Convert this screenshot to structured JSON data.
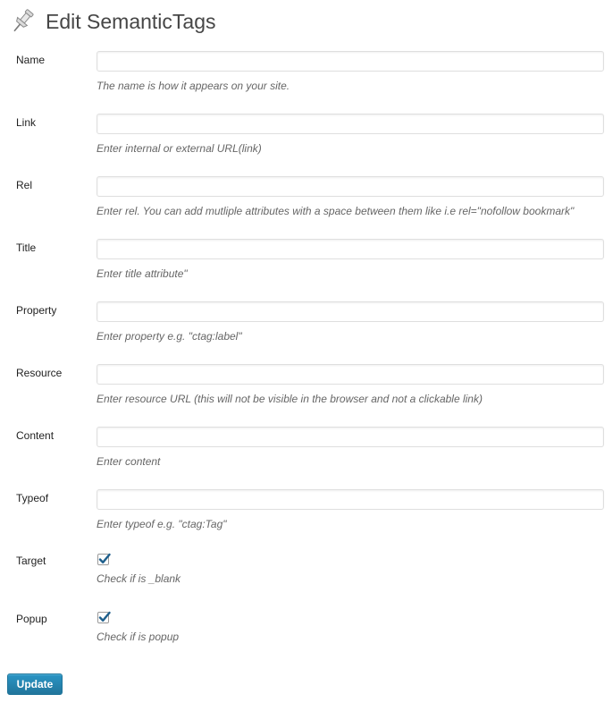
{
  "header": {
    "title": "Edit SemanticTags",
    "icon": "pushpin-icon"
  },
  "fields": [
    {
      "key": "name",
      "label": "Name",
      "value": "",
      "description": "The name is how it appears on your site."
    },
    {
      "key": "link",
      "label": "Link",
      "value": "",
      "description": "Enter internal or external URL(link)"
    },
    {
      "key": "rel",
      "label": "Rel",
      "value": "",
      "description": "Enter rel. You can add mutliple attributes with a space between them like i.e rel=\"nofollow bookmark\""
    },
    {
      "key": "title",
      "label": "Title",
      "value": "",
      "description": "Enter title attribute\""
    },
    {
      "key": "property",
      "label": "Property",
      "value": "",
      "description": "Enter property e.g. \"ctag:label\""
    },
    {
      "key": "resource",
      "label": "Resource",
      "value": "",
      "description": "Enter resource URL (this will not be visible in the browser and not a clickable link)"
    },
    {
      "key": "content",
      "label": "Content",
      "value": "",
      "description": "Enter content"
    },
    {
      "key": "typeof",
      "label": "Typeof",
      "value": "",
      "description": "Enter typeof e.g. \"ctag:Tag\""
    }
  ],
  "checkboxes": [
    {
      "key": "target",
      "label": "Target",
      "checked": true,
      "description": "Check if is _blank"
    },
    {
      "key": "popup",
      "label": "Popup",
      "checked": true,
      "description": "Check if is popup"
    }
  ],
  "actions": {
    "update_label": "Update"
  },
  "colors": {
    "button_primary": "#21759b",
    "check_mark": "#1e5f8c",
    "description_text": "#666666"
  }
}
